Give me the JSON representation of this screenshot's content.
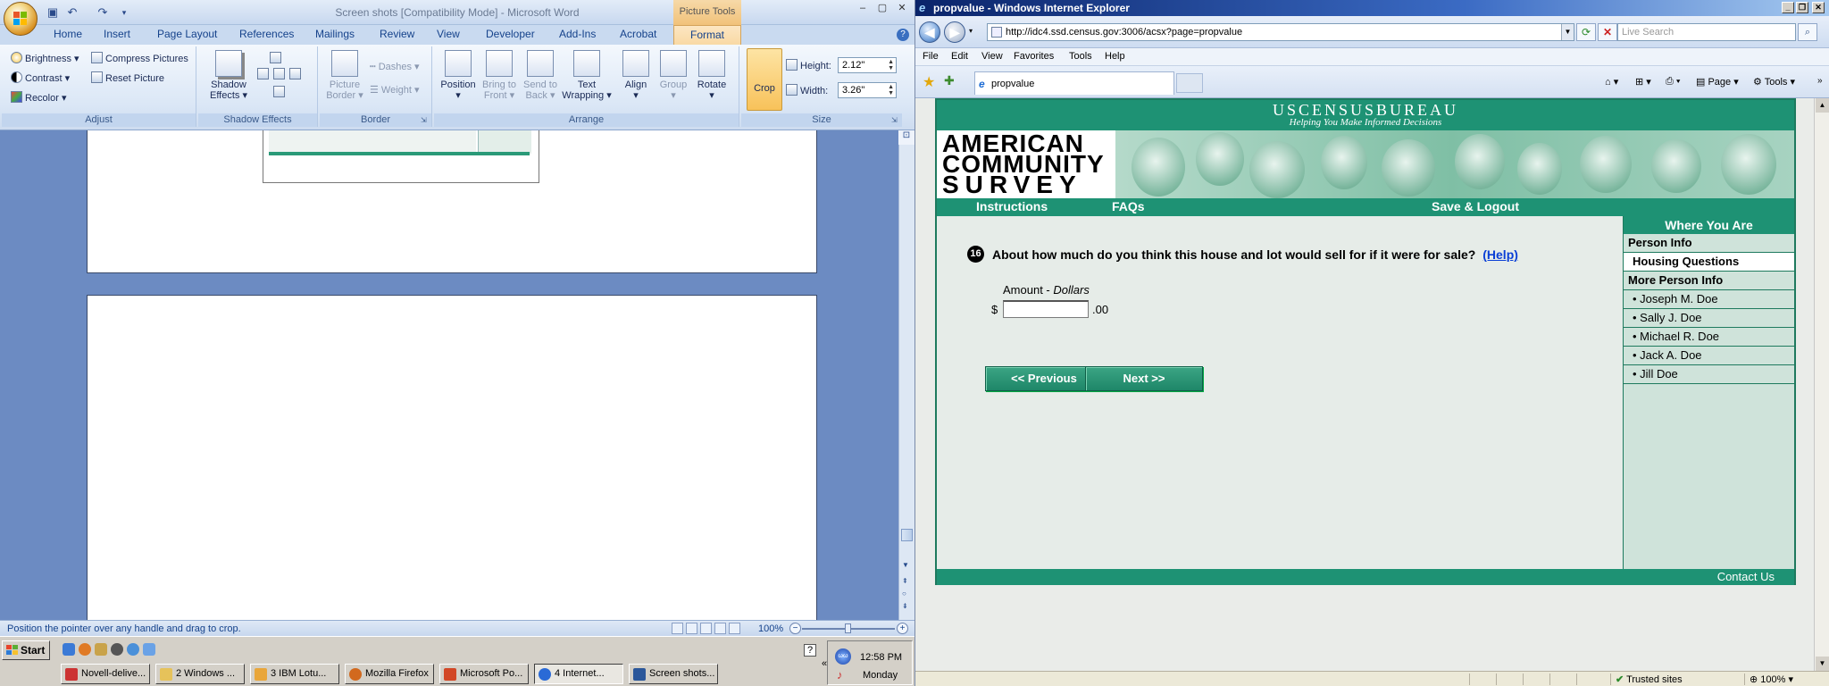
{
  "word": {
    "title": "Screen shots [Compatibility Mode] - Microsoft Word",
    "contextual_tab_group": "Picture Tools",
    "tabs": [
      "Home",
      "Insert",
      "Page Layout",
      "References",
      "Mailings",
      "Review",
      "View",
      "Developer",
      "Add-Ins",
      "Acrobat",
      "Format"
    ],
    "active_tab": "Format",
    "ribbon": {
      "adjust": {
        "label": "Adjust",
        "brightness": "Brightness",
        "contrast": "Contrast",
        "recolor": "Recolor",
        "compress": "Compress Pictures",
        "reset": "Reset Picture"
      },
      "shadow": {
        "label": "Shadow Effects",
        "button": "Shadow Effects"
      },
      "border": {
        "label": "Border",
        "picture_border": "Picture Border",
        "dashes": "Dashes",
        "weight": "Weight"
      },
      "arrange": {
        "label": "Arrange",
        "position": "Position",
        "bring_front": "Bring to Front",
        "send_back": "Send to Back",
        "text_wrapping": "Text Wrapping",
        "align": "Align",
        "group": "Group",
        "rotate": "Rotate"
      },
      "size": {
        "label": "Size",
        "crop": "Crop",
        "height_label": "Height:",
        "height_value": "2.12\"",
        "width_label": "Width:",
        "width_value": "3.26\""
      }
    },
    "status_message": "Position the pointer over any handle and drag to crop.",
    "zoom": "100%",
    "zoom_fraction": 0.5
  },
  "ie": {
    "title": "propvalue - Windows Internet Explorer",
    "url": "http://idc4.ssd.census.gov:3006/acsx?page=propvalue",
    "search_placeholder": "Live Search",
    "menu": [
      "File",
      "Edit",
      "View",
      "Favorites",
      "Tools",
      "Help"
    ],
    "tab_title": "propvalue",
    "command_page": "Page",
    "command_tools": "Tools",
    "status_zone": "Trusted sites",
    "status_zoom": "100%"
  },
  "acs": {
    "header_title": "USCENSUSBUREAU",
    "header_tagline": "Helping You Make Informed Decisions",
    "logo_lines": [
      "AMERICAN",
      "COMMUNITY",
      "SURVEY"
    ],
    "nav": {
      "instructions": "Instructions",
      "faqs": "FAQs",
      "save_logout": "Save & Logout"
    },
    "question": {
      "number": "16",
      "text": "About how much do you think this house and lot would sell for if it were for sale?",
      "help_link": "(Help)",
      "amount_label": "Amount",
      "amount_unit": "Dollars",
      "currency": "$",
      "value": "",
      "cents": ".00"
    },
    "buttons": {
      "previous": "<<   Previous",
      "next": "Next   >>"
    },
    "sidebar": {
      "title": "Where You Are",
      "items": [
        {
          "label": "Person Info",
          "kind": "header"
        },
        {
          "label": "Housing Questions",
          "kind": "current"
        },
        {
          "label": "More Person Info",
          "kind": "header"
        },
        {
          "label": "• Joseph M. Doe",
          "kind": "person"
        },
        {
          "label": "• Sally J. Doe",
          "kind": "person"
        },
        {
          "label": "• Michael R. Doe",
          "kind": "person"
        },
        {
          "label": "• Jack A. Doe",
          "kind": "person"
        },
        {
          "label": "• Jill Doe",
          "kind": "person"
        }
      ]
    },
    "footer_link": "Contact Us",
    "colors": {
      "brand_green": "#1e9274",
      "link_blue": "#0a3fd6"
    }
  },
  "taskbar": {
    "start": "Start",
    "buttons": [
      "Novell-delive...",
      "2 Windows ...",
      "3 IBM Lotu...",
      "Mozilla Firefox",
      "Microsoft Po...",
      "4 Internet...",
      "Screen shots..."
    ],
    "active_index": 5,
    "clock_time": "12:58 PM",
    "clock_day": "Monday"
  }
}
